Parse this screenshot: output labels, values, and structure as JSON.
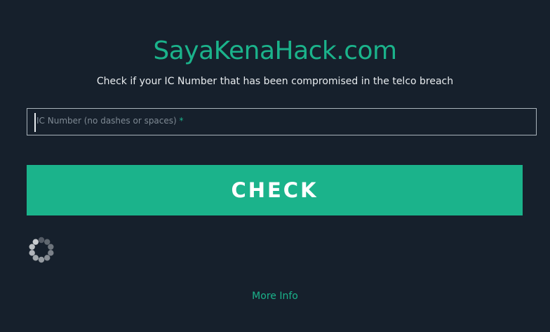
{
  "header": {
    "title": "SayaKenaHack.com",
    "subtitle": "Check if your IC Number that has been compromised in the telco breach"
  },
  "form": {
    "ic_input": {
      "placeholder": "IC Number (no dashes or spaces)",
      "required_marker": "*",
      "value": ""
    },
    "check_button_label": "CHECK"
  },
  "loading": {
    "icon": "spinner-icon"
  },
  "footer": {
    "more_info_label": "More Info"
  },
  "colors": {
    "background": "#16202c",
    "accent": "#1bb38b",
    "text": "#e8ecef",
    "input_border": "#a9b3bb"
  }
}
